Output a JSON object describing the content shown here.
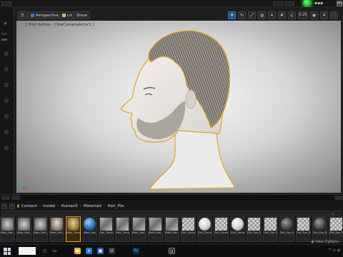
{
  "top_bar": {
    "right_label": "Mo"
  },
  "viewport_toolbar": {
    "perspective_label": "Perspective",
    "lit_label": "Lit",
    "show_label": "Show",
    "snap_value": "0.25",
    "speed_value": "4"
  },
  "viewport": {
    "pilot_label": "[ Pilot Active - CineCameraActor1 ]",
    "subject": "profile-head-hair-preview"
  },
  "content_browser": {
    "breadcrumb": [
      "Content",
      "model",
      "Human5",
      "Materials",
      "Hair_File"
    ],
    "view_options_label": "View Options",
    "assets": [
      {
        "label": "Male_Hair_",
        "thumb": "noise"
      },
      {
        "label": "Male_Hair_",
        "thumb": "noise"
      },
      {
        "label": "Male_Hair_Transparency",
        "thumb": "noise"
      },
      {
        "label": "Male_Hair_Transparency",
        "thumb": "person"
      },
      {
        "label": "Male_Transparency_Inst",
        "thumb": "person-y",
        "selected": true
      },
      {
        "label": "Male_Inst",
        "thumb": "blue"
      },
      {
        "label": "Hair_Transparency",
        "thumb": "tex"
      },
      {
        "label": "Hair_Transparency",
        "thumb": "tex"
      },
      {
        "label": "Male_Hair_Basic",
        "thumb": "tex"
      },
      {
        "label": "Male_Hair_Transparency",
        "thumb": "tex"
      },
      {
        "label": "Male_Hair_Transparency",
        "thumb": "tex"
      },
      {
        "label": "Dirt_Conve_Dirt",
        "thumb": "checker"
      },
      {
        "label": "Dirt_Conve_LENTS",
        "thumb": "white"
      },
      {
        "label": "Dirt_Conve_Dirt",
        "thumb": "checker"
      },
      {
        "label": "Dirt_Conve_LENTS_Inst",
        "thumb": "white"
      },
      {
        "label": "Dirt_Eye_Dirt",
        "thumb": "checker"
      },
      {
        "label": "Dirt_Eye_Dirt_Inst",
        "thumb": "checker"
      },
      {
        "label": "Dirt_Eye_Wetness",
        "thumb": "dark"
      },
      {
        "label": "Dirt_Eye_Wetness_Inst",
        "thumb": "checker"
      },
      {
        "label": "Dirt_Eye_Ringmask",
        "thumb": "dark"
      },
      {
        "label": "Dirt_Eye_Ringmask",
        "thumb": "checker"
      }
    ]
  },
  "taskbar": {
    "pinned": [
      "file-explorer-icon",
      "edge-icon",
      "photos-icon",
      "unreal-icon",
      "photoshop-icon",
      "unreal-icon-2"
    ]
  }
}
